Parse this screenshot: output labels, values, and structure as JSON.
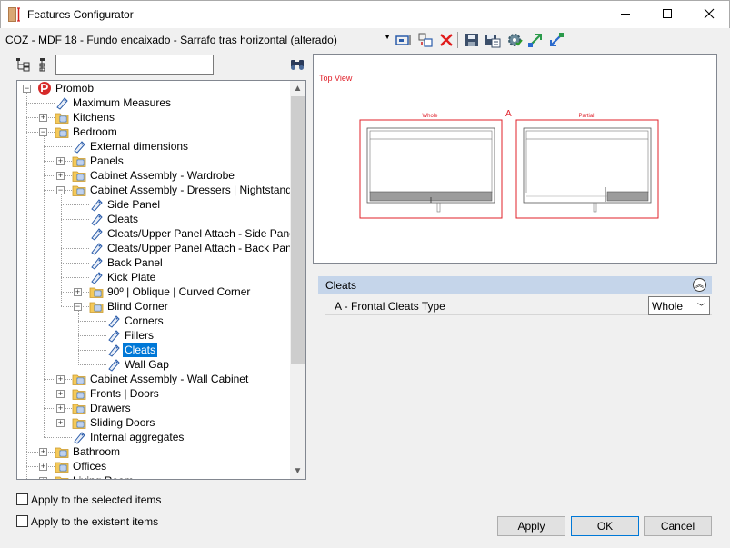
{
  "window": {
    "title": "Features Configurator"
  },
  "toolbar": {
    "combo_value": "COZ - MDF 18 - Fundo encaixado - Sarrafo tras horizontal (alterado)",
    "icons": [
      "select-items-icon",
      "duplicate-icon",
      "delete-icon",
      "save-icon",
      "save-as-icon",
      "settings-icon",
      "export-icon",
      "import-icon"
    ]
  },
  "filter": {
    "value": ""
  },
  "tree": {
    "nodes": [
      {
        "label": "Promob",
        "depth": 0,
        "icon": "promob",
        "expander": "minus"
      },
      {
        "label": "Maximum Measures",
        "depth": 1,
        "icon": "tag"
      },
      {
        "label": "Kitchens",
        "depth": 1,
        "icon": "folder",
        "expander": "plus"
      },
      {
        "label": "Bedroom",
        "depth": 1,
        "icon": "folder",
        "expander": "minus"
      },
      {
        "label": "External dimensions",
        "depth": 2,
        "icon": "tag"
      },
      {
        "label": "Panels",
        "depth": 2,
        "icon": "folder",
        "expander": "plus"
      },
      {
        "label": "Cabinet Assembly - Wardrobe",
        "depth": 2,
        "icon": "folder",
        "expander": "plus"
      },
      {
        "label": "Cabinet Assembly - Dressers | Nightstands",
        "depth": 2,
        "icon": "folder",
        "expander": "minus"
      },
      {
        "label": "Side Panel",
        "depth": 3,
        "icon": "tag"
      },
      {
        "label": "Cleats",
        "depth": 3,
        "icon": "tag"
      },
      {
        "label": "Cleats/Upper Panel Attach - Side Panel",
        "depth": 3,
        "icon": "tag"
      },
      {
        "label": "Cleats/Upper Panel Attach - Back Panel",
        "depth": 3,
        "icon": "tag"
      },
      {
        "label": "Back Panel",
        "depth": 3,
        "icon": "tag"
      },
      {
        "label": " Kick Plate",
        "depth": 3,
        "icon": "tag"
      },
      {
        "label": "90º | Oblique | Curved Corner",
        "depth": 3,
        "icon": "folder",
        "expander": "plus"
      },
      {
        "label": "Blind Corner",
        "depth": 3,
        "icon": "folder",
        "expander": "minus"
      },
      {
        "label": "Corners",
        "depth": 4,
        "icon": "tag"
      },
      {
        "label": "Fillers",
        "depth": 4,
        "icon": "tag"
      },
      {
        "label": "Cleats",
        "depth": 4,
        "icon": "tag",
        "selected": true
      },
      {
        "label": "Wall Gap",
        "depth": 4,
        "icon": "tag"
      },
      {
        "label": "Cabinet Assembly - Wall Cabinet",
        "depth": 2,
        "icon": "folder",
        "expander": "plus"
      },
      {
        "label": "Fronts | Doors",
        "depth": 2,
        "icon": "folder",
        "expander": "plus"
      },
      {
        "label": "Drawers",
        "depth": 2,
        "icon": "folder",
        "expander": "plus"
      },
      {
        "label": "Sliding Doors",
        "depth": 2,
        "icon": "folder",
        "expander": "plus"
      },
      {
        "label": "Internal aggregates",
        "depth": 2,
        "icon": "tag"
      },
      {
        "label": "Bathroom",
        "depth": 1,
        "icon": "folder",
        "expander": "plus"
      },
      {
        "label": "Offices",
        "depth": 1,
        "icon": "folder",
        "expander": "plus"
      },
      {
        "label": "Living Room",
        "depth": 1,
        "icon": "folder",
        "expander": "plus"
      }
    ]
  },
  "preview": {
    "view_title": "Top View",
    "marker": "A",
    "left_label": "Whole",
    "right_label": "Partial",
    "accent_color": "#e0202a"
  },
  "properties": {
    "group": "Cleats",
    "rows": [
      {
        "label": "A - Frontal Cleats Type",
        "value": "Whole"
      }
    ]
  },
  "options": {
    "apply_selected": "Apply to the selected items",
    "apply_existent": "Apply to the existent items"
  },
  "buttons": {
    "apply": "Apply",
    "ok": "OK",
    "cancel": "Cancel"
  }
}
